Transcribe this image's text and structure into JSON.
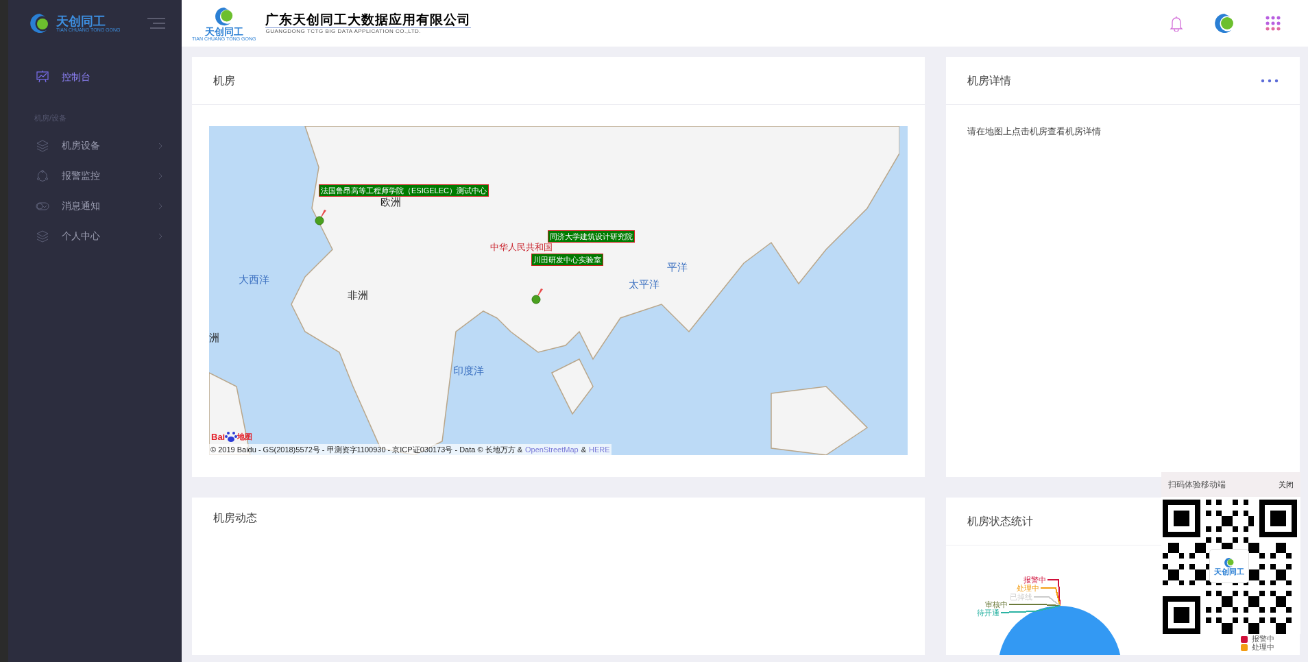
{
  "sidebar": {
    "logo_text": "天创同工",
    "logo_subtext": "TIAN CHUANG TONG GONG",
    "items": [
      {
        "label": "控制台",
        "kind": "chart",
        "selected": true
      }
    ],
    "section": "机房/设备",
    "groups": [
      {
        "label": "机房设备",
        "kind": "layers",
        "selected": false
      },
      {
        "label": "报警监控",
        "kind": "cycle",
        "selected": false
      },
      {
        "label": "消息通知",
        "kind": "toggle",
        "selected": false
      },
      {
        "label": "个人中心",
        "kind": "layers",
        "selected": false
      }
    ]
  },
  "header": {
    "logo_text": "天创同工",
    "logo_subtext": "TIAN CHUANG TONG GONG",
    "company": "广东天创同工大数据应用有限公司",
    "company_en": "GUANGDONG TCTG BIG DATA APPLICATION CO.,LTD."
  },
  "map_card": {
    "title": "机房",
    "places": [
      {
        "label": "欧洲",
        "kind": "continent"
      },
      {
        "label": "中华人民共和国",
        "kind": "country"
      },
      {
        "label": "大西洋",
        "kind": "ocean"
      },
      {
        "label": "太平洋",
        "kind": "ocean"
      },
      {
        "label": "平洋",
        "kind": "ocean"
      },
      {
        "label": "非洲",
        "kind": "continent"
      },
      {
        "label": "洲",
        "kind": "continent"
      },
      {
        "label": "印度洋",
        "kind": "ocean"
      }
    ],
    "markers": [
      {
        "label": "法国鲁昂高等工程师学院（ESIGELEC）测试中心"
      },
      {
        "label": "同济大学建筑设计研究院"
      },
      {
        "label": "川田研发中心实验室"
      }
    ],
    "map_logo": "地图",
    "map_logo_brand": "Bai",
    "attribution": "© 2019 Baidu - GS(2018)5572号 - 甲测资字1100930 - 京ICP证030173号 - Data © 长地万方 &",
    "links": [
      "OpenStreetMap",
      "HERE"
    ],
    "link_sep": "&"
  },
  "detail_card": {
    "title": "机房详情",
    "hint": "请在地图上点击机房查看机房详情"
  },
  "activity_card": {
    "title": "机房动态"
  },
  "stats_card": {
    "title": "机房状态统计",
    "pie_labels": [
      {
        "label": "报警中",
        "color": "#d0103a"
      },
      {
        "label": "处理中",
        "color": "#f39c12"
      },
      {
        "label": "已掉线",
        "color": "#cccccc"
      },
      {
        "label": "审核中",
        "color": "#6b7a3a"
      },
      {
        "label": "待开通",
        "color": "#2bb3a3"
      }
    ],
    "legend": [
      {
        "label": "报警中",
        "color": "#d0103a"
      },
      {
        "label": "处理中",
        "color": "#f39c12"
      }
    ]
  },
  "qr_popup": {
    "title": "扫码体验移动端",
    "close": "关闭",
    "logo_text": "天创同工"
  }
}
